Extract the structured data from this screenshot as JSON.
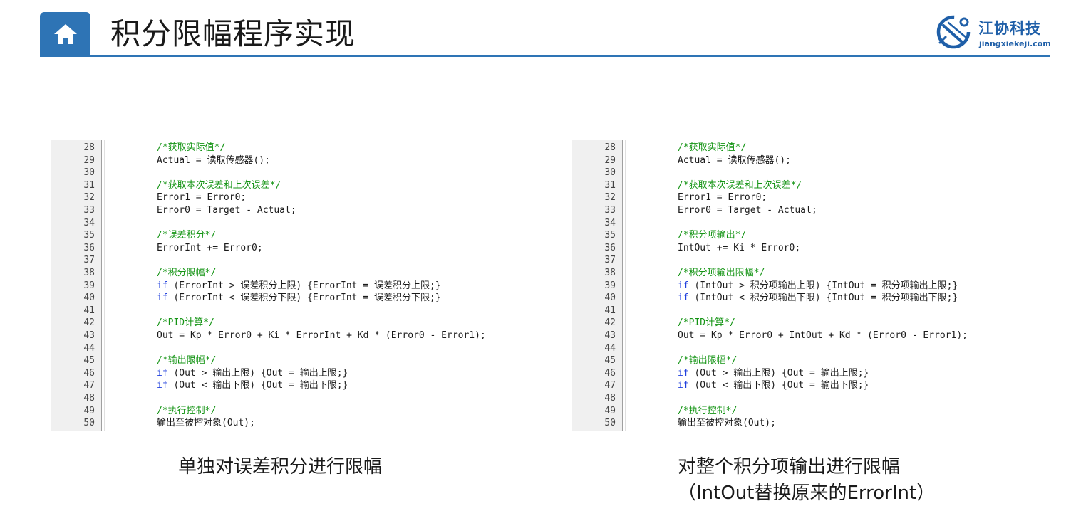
{
  "header": {
    "title": "积分限幅程序实现",
    "logo_name": "江协科技",
    "logo_url": "jiangxiekeji.com"
  },
  "panels": [
    {
      "lines": [
        {
          "n": "28",
          "text": "/*获取实际值*/",
          "type": "comment"
        },
        {
          "n": "29",
          "text": "Actual = 读取传感器();",
          "type": "code"
        },
        {
          "n": "30",
          "text": "",
          "type": "code"
        },
        {
          "n": "31",
          "text": "/*获取本次误差和上次误差*/",
          "type": "comment"
        },
        {
          "n": "32",
          "text": "Error1 = Error0;",
          "type": "code"
        },
        {
          "n": "33",
          "text": "Error0 = Target - Actual;",
          "type": "code"
        },
        {
          "n": "34",
          "text": "",
          "type": "code"
        },
        {
          "n": "35",
          "text": "/*误差积分*/",
          "type": "comment"
        },
        {
          "n": "36",
          "text": "ErrorInt += Error0;",
          "type": "code"
        },
        {
          "n": "37",
          "text": "",
          "type": "code"
        },
        {
          "n": "38",
          "text": "/*积分限幅*/",
          "type": "comment"
        },
        {
          "n": "39",
          "kw": "if",
          "text": " (ErrorInt > 误差积分上限) {ErrorInt = 误差积分上限;}",
          "type": "code"
        },
        {
          "n": "40",
          "kw": "if",
          "text": " (ErrorInt < 误差积分下限) {ErrorInt = 误差积分下限;}",
          "type": "code"
        },
        {
          "n": "41",
          "text": "",
          "type": "code"
        },
        {
          "n": "42",
          "text": "/*PID计算*/",
          "type": "comment"
        },
        {
          "n": "43",
          "text": "Out = Kp * Error0 + Ki * ErrorInt + Kd * (Error0 - Error1);",
          "type": "code"
        },
        {
          "n": "44",
          "text": "",
          "type": "code"
        },
        {
          "n": "45",
          "text": "/*输出限幅*/",
          "type": "comment"
        },
        {
          "n": "46",
          "kw": "if",
          "text": " (Out > 输出上限) {Out = 输出上限;}",
          "type": "code"
        },
        {
          "n": "47",
          "kw": "if",
          "text": " (Out < 输出下限) {Out = 输出下限;}",
          "type": "code"
        },
        {
          "n": "48",
          "text": "",
          "type": "code"
        },
        {
          "n": "49",
          "text": "/*执行控制*/",
          "type": "comment"
        },
        {
          "n": "50",
          "text": "输出至被控对象(Out);",
          "type": "code"
        }
      ],
      "caption": [
        "单独对误差积分进行限幅"
      ]
    },
    {
      "lines": [
        {
          "n": "28",
          "text": "/*获取实际值*/",
          "type": "comment"
        },
        {
          "n": "29",
          "text": "Actual = 读取传感器();",
          "type": "code"
        },
        {
          "n": "30",
          "text": "",
          "type": "code"
        },
        {
          "n": "31",
          "text": "/*获取本次误差和上次误差*/",
          "type": "comment"
        },
        {
          "n": "32",
          "text": "Error1 = Error0;",
          "type": "code"
        },
        {
          "n": "33",
          "text": "Error0 = Target - Actual;",
          "type": "code"
        },
        {
          "n": "34",
          "text": "",
          "type": "code"
        },
        {
          "n": "35",
          "text": "/*积分项输出*/",
          "type": "comment"
        },
        {
          "n": "36",
          "text": "IntOut += Ki * Error0;",
          "type": "code"
        },
        {
          "n": "37",
          "text": "",
          "type": "code"
        },
        {
          "n": "38",
          "text": "/*积分项输出限幅*/",
          "type": "comment"
        },
        {
          "n": "39",
          "kw": "if",
          "text": " (IntOut > 积分项输出上限) {IntOut = 积分项输出上限;}",
          "type": "code"
        },
        {
          "n": "40",
          "kw": "if",
          "text": " (IntOut < 积分项输出下限) {IntOut = 积分项输出下限;}",
          "type": "code"
        },
        {
          "n": "41",
          "text": "",
          "type": "code"
        },
        {
          "n": "42",
          "text": "/*PID计算*/",
          "type": "comment"
        },
        {
          "n": "43",
          "text": "Out = Kp * Error0 + IntOut + Kd * (Error0 - Error1);",
          "type": "code"
        },
        {
          "n": "44",
          "text": "",
          "type": "code"
        },
        {
          "n": "45",
          "text": "/*输出限幅*/",
          "type": "comment"
        },
        {
          "n": "46",
          "kw": "if",
          "text": " (Out > 输出上限) {Out = 输出上限;}",
          "type": "code"
        },
        {
          "n": "47",
          "kw": "if",
          "text": " (Out < 输出下限) {Out = 输出下限;}",
          "type": "code"
        },
        {
          "n": "48",
          "text": "",
          "type": "code"
        },
        {
          "n": "49",
          "text": "/*执行控制*/",
          "type": "comment"
        },
        {
          "n": "50",
          "text": "输出至被控对象(Out);",
          "type": "code"
        }
      ],
      "caption": [
        "对整个积分项输出进行限幅",
        "（IntOut替换原来的ErrorInt）"
      ]
    }
  ],
  "colors": {
    "accent": "#2e74b5",
    "comment": "#149414",
    "keyword": "#1f3fdd"
  }
}
